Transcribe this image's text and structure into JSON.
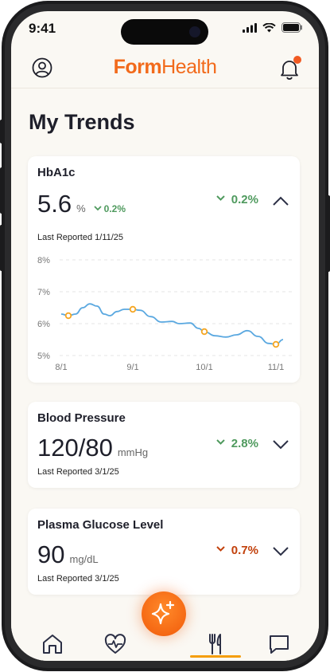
{
  "status_bar": {
    "time": "9:41"
  },
  "header": {
    "logo_form": "Form",
    "logo_health": "Health",
    "profile_icon": "user-circle-icon",
    "bell_icon": "bell-icon"
  },
  "page": {
    "title": "My Trends"
  },
  "cards": [
    {
      "title": "HbA1c",
      "value": "5.6",
      "unit": "%",
      "inline_delta": "0.2%",
      "delta": "0.2%",
      "delta_direction": "down",
      "reported": "Last Reported 1/11/25",
      "expanded": true
    },
    {
      "title": "Blood Pressure",
      "value": "120/80",
      "unit": "mmHg",
      "delta": "2.8%",
      "delta_direction": "down",
      "reported": "Last Reported 3/1/25",
      "expanded": false
    },
    {
      "title": "Plasma Glucose Level",
      "value": "90",
      "unit": "mg/dL",
      "delta": "0.7%",
      "delta_direction": "down",
      "reported": "Last Reported 3/1/25",
      "expanded": false
    }
  ],
  "colors": {
    "brand": "#f26a1b",
    "good": "#4f9a5e",
    "bad": "#c2410c",
    "line": "#5aa8e0",
    "marker": "#f5a623"
  },
  "chart_data": {
    "type": "line",
    "title": "",
    "xlabel": "",
    "ylabel": "",
    "x_ticks": [
      "8/1",
      "9/1",
      "10/1",
      "11/1"
    ],
    "y_ticks": [
      "8%",
      "7%",
      "6%",
      "5%"
    ],
    "ylim": [
      5,
      8
    ],
    "grid": true,
    "series": [
      {
        "x": [
          0.0,
          0.1,
          0.2,
          0.3,
          0.4,
          0.5,
          0.6,
          0.68,
          0.78,
          0.88,
          1.0,
          1.1,
          1.25,
          1.4,
          1.55,
          1.65,
          1.8,
          1.92,
          2.0,
          2.15,
          2.3,
          2.45,
          2.6,
          2.75,
          2.9,
          3.0,
          3.1
        ],
        "y": [
          6.3,
          6.25,
          6.3,
          6.5,
          6.62,
          6.55,
          6.3,
          6.25,
          6.38,
          6.45,
          6.45,
          6.42,
          6.22,
          6.05,
          6.07,
          6.0,
          6.02,
          5.85,
          5.75,
          5.62,
          5.58,
          5.65,
          5.78,
          5.6,
          5.38,
          5.35,
          5.5
        ]
      }
    ],
    "markers": [
      {
        "x": 0.1,
        "y": 6.25
      },
      {
        "x": 1.0,
        "y": 6.45
      },
      {
        "x": 2.0,
        "y": 5.75
      },
      {
        "x": 3.0,
        "y": 5.35
      }
    ]
  },
  "nav": {
    "items": [
      {
        "icon": "home-icon"
      },
      {
        "icon": "heart-pulse-icon"
      },
      {
        "icon": "sparkle-icon"
      },
      {
        "icon": "fork-knife-icon"
      },
      {
        "icon": "chat-icon"
      }
    ]
  }
}
